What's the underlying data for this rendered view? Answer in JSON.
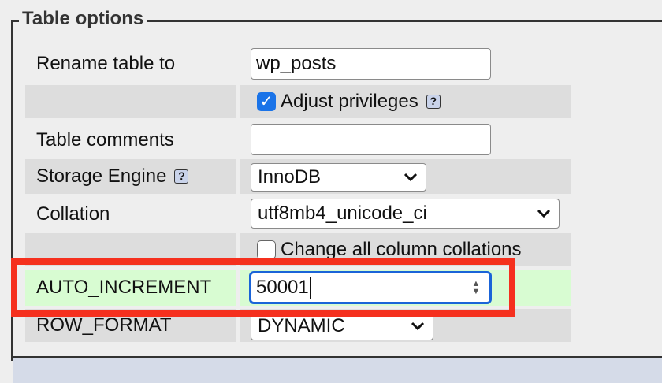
{
  "legend": "Table options",
  "rows": {
    "rename": {
      "label": "Rename table to",
      "value": "wp_posts"
    },
    "privileges": {
      "label": "Adjust privileges",
      "checked": true
    },
    "comments": {
      "label": "Table comments",
      "value": ""
    },
    "engine": {
      "label": "Storage Engine",
      "value": "InnoDB"
    },
    "collation": {
      "label": "Collation",
      "value": "utf8mb4_unicode_ci"
    },
    "change_collations": {
      "label": "Change all column collations",
      "checked": false
    },
    "auto_increment": {
      "label": "AUTO_INCREMENT",
      "value": "50001"
    },
    "row_format": {
      "label": "ROW_FORMAT",
      "value": "DYNAMIC"
    }
  },
  "icons": {
    "help": "help-icon",
    "dropdown": "chevron-down-icon",
    "spinner": "spinner-icon"
  },
  "colors": {
    "highlight": "#f5301e",
    "focus": "#1a64d8",
    "checkbox": "#1a73e8",
    "row_highlight": "#d8fcd2"
  }
}
